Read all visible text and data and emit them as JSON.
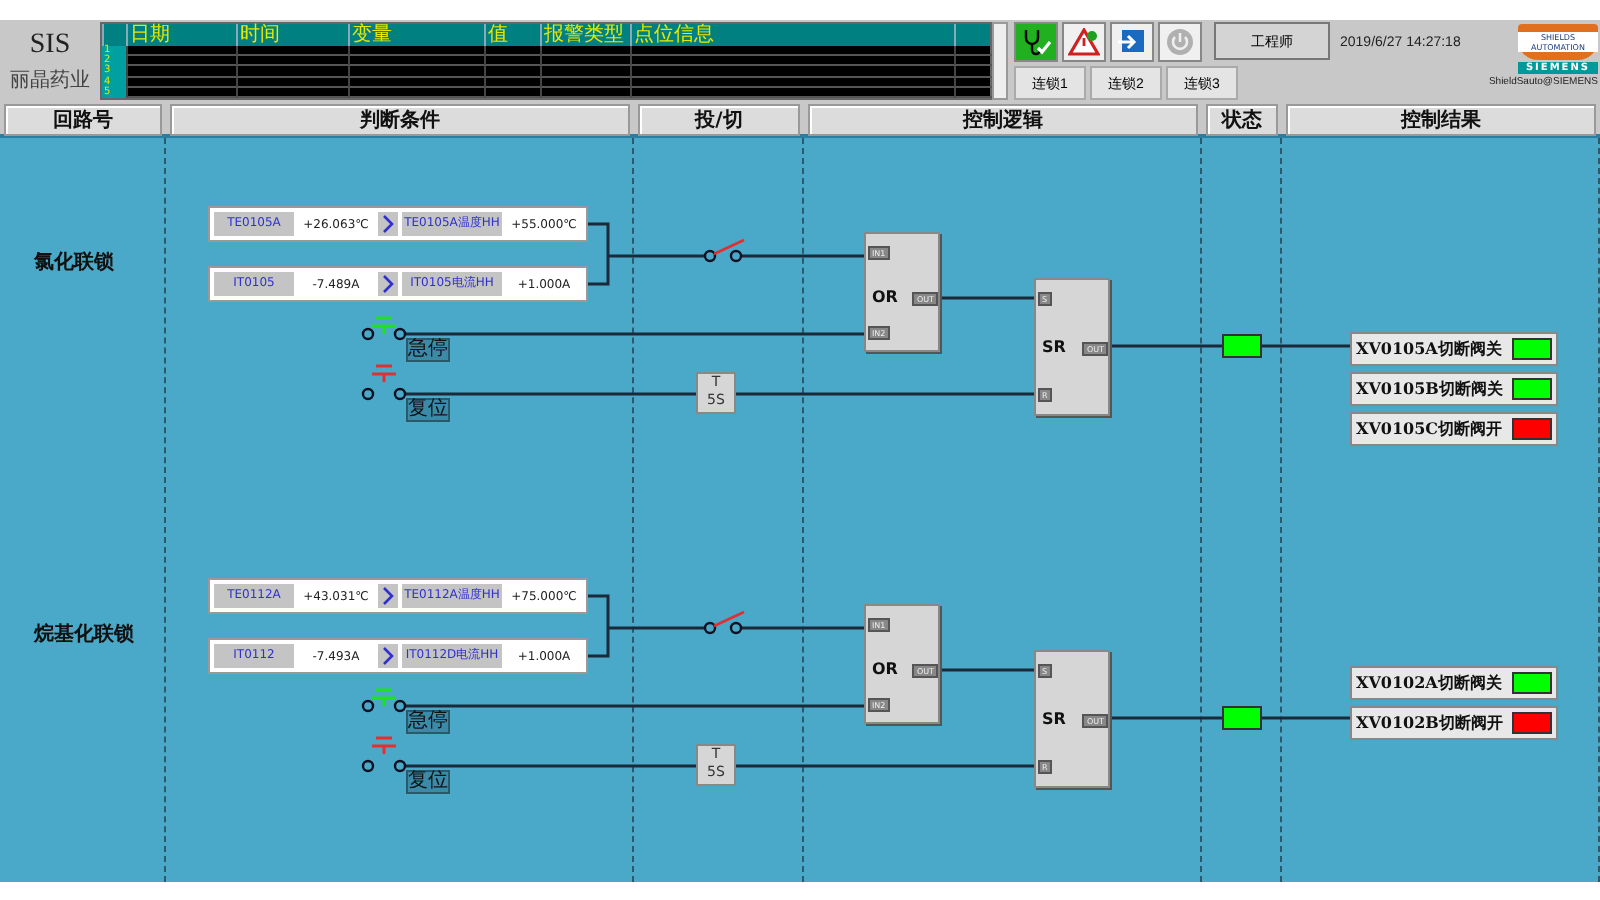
{
  "app": {
    "title": "SIS",
    "company": "丽晶药业"
  },
  "alarm_table": {
    "columns": [
      "日期",
      "时间",
      "变量",
      "值",
      "报警类型",
      "点位信息"
    ],
    "row_numbers": [
      "1",
      "2",
      "3",
      "4",
      "5"
    ]
  },
  "user_button": "工程师",
  "interlock_buttons": [
    "连锁1",
    "连锁2",
    "连锁3"
  ],
  "datetime": "2019/6/27 14:27:18",
  "logo": {
    "brand": "SHIELDS AUTOMATION",
    "partner": "SIEMENS",
    "caption": "ShieldSauto@SIEMENS"
  },
  "columns": [
    "回路号",
    "判断条件",
    "投/切",
    "控制逻辑",
    "状态",
    "控制结果"
  ],
  "loops": [
    {
      "name": "氯化联锁",
      "conditions": [
        {
          "tag": "TE0105A",
          "value": "+26.063℃",
          "limit_tag": "TE0105A温度HH",
          "limit": "+55.000℃"
        },
        {
          "tag": "IT0105",
          "value": "-7.489A",
          "limit_tag": "IT0105电流HH",
          "limit": "+1.000A"
        }
      ],
      "bypass": {
        "closed": false
      },
      "estop": {
        "label": "急停",
        "closed": true
      },
      "reset": {
        "label": "复位",
        "closed": false
      },
      "timer": {
        "label": "T",
        "delay": "5S"
      },
      "or_gate": {
        "label": "OR",
        "inputs": [
          "IN1",
          "IN2"
        ],
        "output": "OUT"
      },
      "sr_latch": {
        "label": "SR",
        "inputs": [
          "S",
          "R"
        ],
        "output": "OUT"
      },
      "status": {
        "active": true
      },
      "results": [
        {
          "name": "XV0105A切断阀关",
          "color": "#00ff00"
        },
        {
          "name": "XV0105B切断阀关",
          "color": "#00ff00"
        },
        {
          "name": "XV0105C切断阀开",
          "color": "#ff0000"
        }
      ]
    },
    {
      "name": "烷基化联锁",
      "conditions": [
        {
          "tag": "TE0112A",
          "value": "+43.031℃",
          "limit_tag": "TE0112A温度HH",
          "limit": "+75.000℃"
        },
        {
          "tag": "IT0112",
          "value": "-7.493A",
          "limit_tag": "IT0112D电流HH",
          "limit": "+1.000A"
        }
      ],
      "bypass": {
        "closed": false
      },
      "estop": {
        "label": "急停",
        "closed": true
      },
      "reset": {
        "label": "复位",
        "closed": false
      },
      "timer": {
        "label": "T",
        "delay": "5S"
      },
      "or_gate": {
        "label": "OR",
        "inputs": [
          "IN1",
          "IN2"
        ],
        "output": "OUT"
      },
      "sr_latch": {
        "label": "SR",
        "inputs": [
          "S",
          "R"
        ],
        "output": "OUT"
      },
      "status": {
        "active": true
      },
      "results": [
        {
          "name": "XV0102A切断阀关",
          "color": "#00ff00"
        },
        {
          "name": "XV0102B切断阀开",
          "color": "#ff0000"
        }
      ]
    }
  ]
}
